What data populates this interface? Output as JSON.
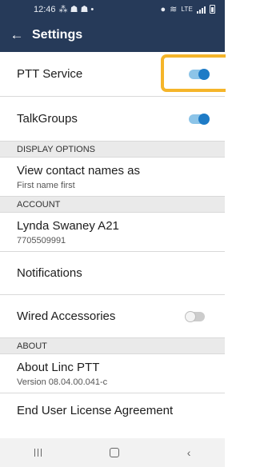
{
  "status_bar": {
    "time": "12:46",
    "network": "LTE"
  },
  "app_bar": {
    "title": "Settings"
  },
  "rows": {
    "ptt_service": {
      "label": "PTT Service",
      "enabled": true
    },
    "talkgroups": {
      "label": "TalkGroups",
      "enabled": true
    },
    "display_options_header": "DISPLAY OPTIONS",
    "view_contact_names": {
      "label": "View contact names as",
      "value": "First name first"
    },
    "account_header": "ACCOUNT",
    "account": {
      "name": "Lynda Swaney A21",
      "number": "7705509991"
    },
    "notifications": {
      "label": "Notifications"
    },
    "wired_accessories": {
      "label": "Wired Accessories",
      "enabled": false
    },
    "about_header": "ABOUT",
    "about": {
      "label": "About Linc PTT",
      "version": "Version 08.04.00.041-c"
    },
    "eula": {
      "label": "End User License Agreement"
    }
  },
  "colors": {
    "header_bg": "#263a59",
    "toggle_on": "#1e7bc6",
    "highlight": "#f5b52a"
  },
  "icons": {
    "back": "arrow-left-icon",
    "nav_recents": "recents-icon",
    "nav_home": "home-icon",
    "nav_back": "nav-back-icon"
  }
}
